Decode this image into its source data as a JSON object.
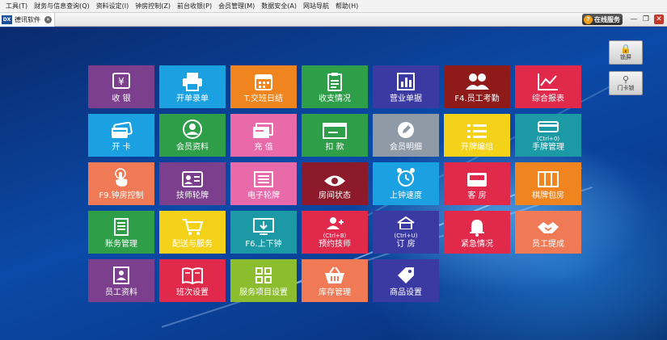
{
  "menu": [
    "工具(T)",
    "财务与信息查询(Q)",
    "资料设定(I)",
    "钟房控制(Z)",
    "前台收银(P)",
    "会员管理(M)",
    "数据安全(A)",
    "网站导航",
    "帮助(H)"
  ],
  "tab": {
    "logo": "DX",
    "label": "德讯软件",
    "close": "✕"
  },
  "online": {
    "icon": "?",
    "label": "在线服务"
  },
  "window": {
    "minimize": "—",
    "restore": "❐",
    "close": "✕"
  },
  "side_buttons": [
    {
      "icon": "🔒",
      "label": "锁屏"
    },
    {
      "icon": "⚲",
      "label": "门卡锁"
    }
  ],
  "colors": {
    "purple": "#7b3f8e",
    "cyan": "#1ba1e2",
    "orange": "#f0841f",
    "green": "#2e9e48",
    "indigo": "#3b3aa3",
    "maroon": "#8e1a1a",
    "red": "#e0294b",
    "gray": "#8e9aa6",
    "pink": "#e96aa8",
    "yellow": "#f5d21a",
    "teal": "#1b9aa6",
    "lime": "#8bbd2e",
    "gold": "#e6b800",
    "brown": "#b8441c",
    "salmon": "#ef7a55",
    "darkred": "#8c1a2a"
  },
  "tiles": [
    {
      "label": "收 银",
      "icon": "cash-register-icon"
    },
    {
      "label": "开单录单",
      "icon": "printer-icon"
    },
    {
      "label": "T.交班日结",
      "icon": "calendar-icon"
    },
    {
      "label": "收支情况",
      "icon": "clipboard-icon"
    },
    {
      "label": "营业单据",
      "icon": "bar-chart-icon"
    },
    {
      "label": "F4.员工考勤",
      "icon": "users-icon"
    },
    {
      "label": "综合报表",
      "icon": "line-chart-icon"
    },
    {
      "label": "开 卡",
      "icon": "card-icon"
    },
    {
      "label": "会员资料",
      "icon": "member-icon"
    },
    {
      "label": "充 值",
      "icon": "recharge-icon"
    },
    {
      "label": "扣 款",
      "icon": "deduct-icon"
    },
    {
      "label": "会员明细",
      "icon": "edit-icon"
    },
    {
      "label": "开牌编组",
      "icon": "list-icon"
    },
    {
      "label": "手牌管理",
      "icon": "wristband-icon",
      "badge": "(Ctrl+0)"
    },
    {
      "label": "F9.钟房控制",
      "icon": "touch-icon"
    },
    {
      "label": "技师轮牌",
      "icon": "id-card-icon"
    },
    {
      "label": "电子轮牌",
      "icon": "e-board-icon"
    },
    {
      "label": "房间状态",
      "icon": "eye-icon"
    },
    {
      "label": "上钟速度",
      "icon": "alarm-clock-icon"
    },
    {
      "label": "客 房",
      "icon": "inbox-icon"
    },
    {
      "label": "棋牌包房",
      "icon": "cabinet-icon"
    },
    {
      "label": "账务管理",
      "icon": "ledger-icon"
    },
    {
      "label": "配送与服务",
      "icon": "cart-icon"
    },
    {
      "label": "F6.上下钟",
      "icon": "monitor-download-icon"
    },
    {
      "label": "预约技师",
      "icon": "user-plus-icon",
      "badge": "(Ctrl+B)"
    },
    {
      "label": "订 房",
      "icon": "home-icon",
      "badge": "(Ctrl+U)"
    },
    {
      "label": "紧急情况",
      "icon": "bell-icon"
    },
    {
      "label": "员工提成",
      "icon": "handshake-icon"
    },
    {
      "label": "员工资料",
      "icon": "profile-icon"
    },
    {
      "label": "班次设置",
      "icon": "book-icon"
    },
    {
      "label": "服务项目设置",
      "icon": "grid-icon"
    },
    {
      "label": "库存管理",
      "icon": "basket-icon"
    },
    {
      "label": "商品设置",
      "icon": "tag-icon"
    }
  ]
}
